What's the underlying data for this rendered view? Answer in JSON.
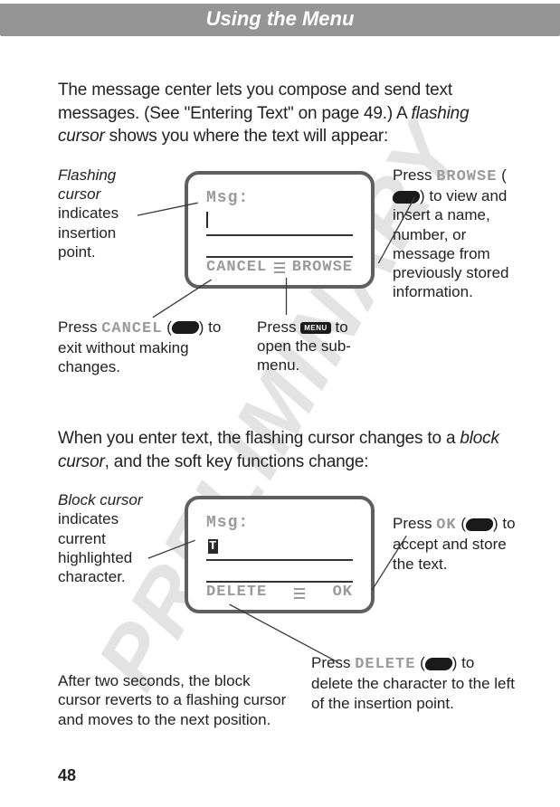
{
  "header": "Using the Menu",
  "watermark": "PRELIMINARY",
  "intro": {
    "line1": "The message center lets you compose and send text messages. (See \"Entering Text\" on page 49.) A ",
    "em1": "flashing cursor",
    "line1b": " shows you where the text will appear:"
  },
  "screen1": {
    "msg_label": "Msg",
    "colon": ":",
    "cancel": "CANCEL",
    "browse": "BROWSE"
  },
  "ann1": {
    "left": "Flashing cursor indicates insertion point.",
    "left_em": "Flashing cursor",
    "left_plain": " indicates insertion point.",
    "right_pre": "Press ",
    "right_sk": "BROWSE",
    "right_post": " (",
    "right_tail": ") to view and insert a name, number, or message from previously stored information.",
    "bl_pre": "Press ",
    "bl_sk": "CANCEL",
    "bl_post": " (",
    "bl_tail": ") to exit without making changes.",
    "bm_pre": "Press ",
    "bm_tail": " to open the sub-menu."
  },
  "mid": {
    "a": "When you enter text, the flashing cursor changes to a ",
    "em": "block cursor",
    "b": ", and the soft key functions change:"
  },
  "screen2": {
    "msg_label": "Msg",
    "colon": ":",
    "delete": "DELETE",
    "ok": "OK"
  },
  "ann2": {
    "left_em": "Block cursor",
    "left_plain": " indicates current highlighted character.",
    "right_pre": "Press ",
    "right_sk": "OK",
    "right_post": " (",
    "right_tail": ") to accept and store the text.",
    "bl": "After two seconds, the block cursor reverts to a flashing cursor and moves to the next position.",
    "br_pre": "Press ",
    "br_sk": "DELETE",
    "br_post": " (",
    "br_tail": ") to delete the character to the left of the insertion point."
  },
  "page_number": "48"
}
